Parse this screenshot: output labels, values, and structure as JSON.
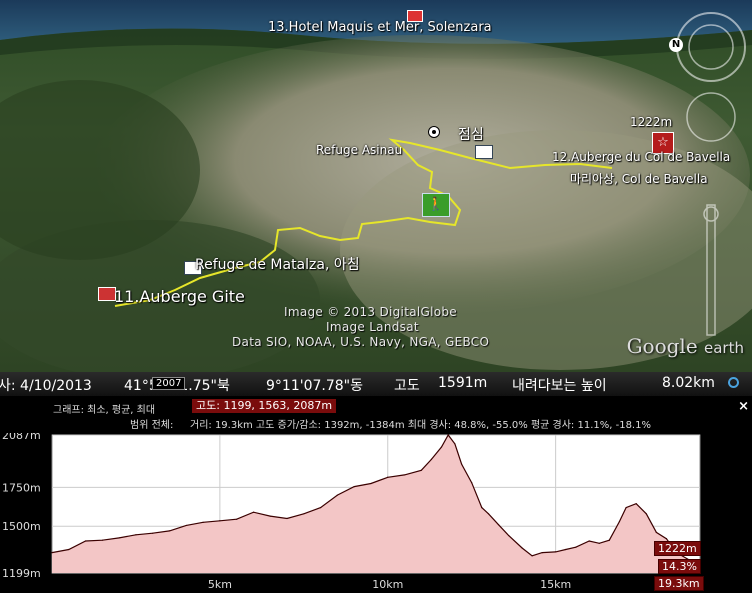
{
  "map": {
    "placemarks": {
      "hotel": "13.Hotel Maquis et Mer, Solenzara",
      "lunch": "점심",
      "refuge_asinau": "Refuge Asinau",
      "auberge_col_num": "12.Auberge du Col de Bavella",
      "col_de_bavella_ko": "마리아상, Col de Bavella",
      "refuge_matalza": "Refuge de Matalza, 아침",
      "auberge_gite": "11.Auberge Gite",
      "elevation_1222": "1222m"
    },
    "attribution": {
      "line1": "Image © 2013 DigitalGlobe",
      "line2": "Image Landsat",
      "line3": "Data SIO, NOAA, U.S. Navy, NGA, GEBCO"
    },
    "logo": {
      "google": "Google",
      "earth": "earth"
    },
    "compass_letter": "N"
  },
  "status_bar": {
    "date": "사: 4/10/2013",
    "year_badge": "2007",
    "lat": "41°51'41.75\"북",
    "lon": "9°11'07.78\"동",
    "elevation_label": "고도",
    "elevation_value": "1591m",
    "eye_alt_label": "내려다보는 높이",
    "eye_alt_value": "8.02km"
  },
  "profile": {
    "graph_label": "그래프: 최소, 평균, 최대",
    "elev_tag": "고도: 1199, 1563, 2087m",
    "range_label": "범위 전체:",
    "range_stats": "거리: 19.3km 고도 증가/감소: 1392m, -1384m 최대 경사: 48.8%, -55.0% 평균 경사: 11.1%, -18.1%",
    "close_label": "×",
    "cursor_tags": {
      "elev": "1222m",
      "slope": "14.3%",
      "dist": "19.3km"
    }
  },
  "chart_data": {
    "type": "area",
    "xlabel": "",
    "ylabel": "",
    "x_ticks": [
      "5km",
      "10km",
      "15km"
    ],
    "x_tick_values": [
      5,
      10,
      15
    ],
    "y_ticks": [
      "2087m",
      "1750m",
      "1500m",
      "1199m"
    ],
    "y_tick_values": [
      2087,
      1750,
      1500,
      1199
    ],
    "xlim": [
      0,
      19.3
    ],
    "ylim": [
      1199,
      2087
    ],
    "grid": true,
    "series": [
      {
        "x": [
          0.0,
          0.5,
          1.0,
          1.5,
          2.0,
          2.5,
          3.0,
          3.5,
          4.0,
          4.5,
          5.0,
          5.5,
          6.0,
          6.5,
          7.0,
          7.5,
          8.0,
          8.5,
          9.0,
          9.5,
          10.0,
          10.5,
          11.0,
          11.3,
          11.6,
          11.8,
          12.0,
          12.2,
          12.5,
          12.8,
          13.0,
          13.3,
          13.6,
          14.0,
          14.3,
          14.6,
          15.0,
          15.3,
          15.6,
          16.0,
          16.3,
          16.6,
          16.9,
          17.1,
          17.4,
          17.7,
          18.0,
          18.3,
          18.6,
          19.0,
          19.3
        ],
        "y": [
          1330,
          1350,
          1405,
          1410,
          1425,
          1445,
          1455,
          1470,
          1505,
          1525,
          1535,
          1545,
          1590,
          1565,
          1550,
          1580,
          1620,
          1700,
          1755,
          1775,
          1815,
          1830,
          1860,
          1930,
          2010,
          2087,
          2030,
          1900,
          1780,
          1620,
          1580,
          1510,
          1440,
          1360,
          1310,
          1330,
          1335,
          1350,
          1365,
          1405,
          1390,
          1410,
          1530,
          1620,
          1645,
          1580,
          1460,
          1420,
          1330,
          1280,
          1222
        ]
      }
    ],
    "fill_color": "#f3c6c6",
    "line_color": "#3a0000"
  },
  "colors": {
    "track": "#e6e62a",
    "status_bg": "#1c1c1c",
    "tag_red": "#7a0c0c"
  }
}
